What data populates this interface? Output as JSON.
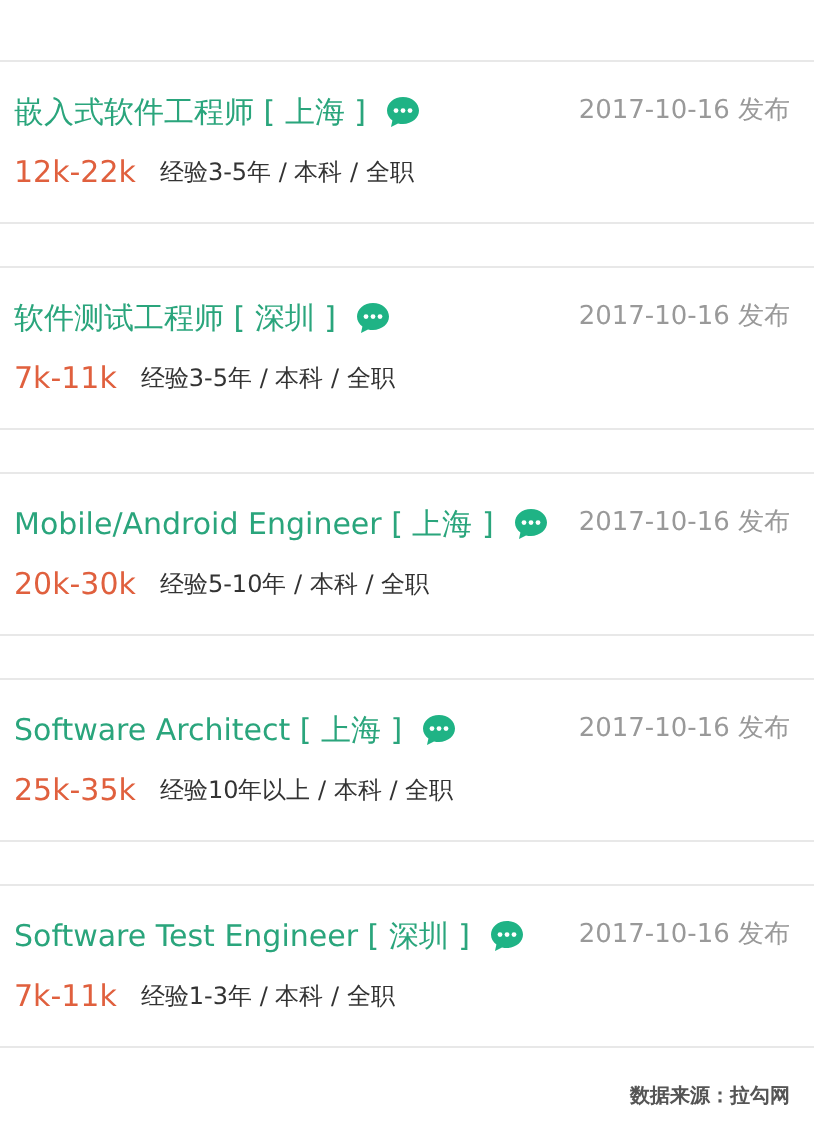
{
  "jobs": [
    {
      "title": "嵌入式软件工程师 [ 上海 ]",
      "date": "2017-10-16 发布",
      "salary": "12k-22k",
      "details": "经验3-5年 / 本科 / 全职"
    },
    {
      "title": "软件测试工程师 [ 深圳 ]",
      "date": "2017-10-16 发布",
      "salary": "7k-11k",
      "details": "经验3-5年 / 本科 / 全职"
    },
    {
      "title": "Mobile/Android Engineer [ 上海 ]",
      "date": "2017-10-16 发布",
      "salary": "20k-30k",
      "details": "经验5-10年 / 本科 / 全职"
    },
    {
      "title": "Software Architect [ 上海 ]",
      "date": "2017-10-16 发布",
      "salary": "25k-35k",
      "details": "经验10年以上 / 本科 / 全职"
    },
    {
      "title": "Software Test Engineer [ 深圳 ]",
      "date": "2017-10-16 发布",
      "salary": "7k-11k",
      "details": "经验1-3年 / 本科 / 全职"
    }
  ],
  "source": "数据来源：拉勾网"
}
